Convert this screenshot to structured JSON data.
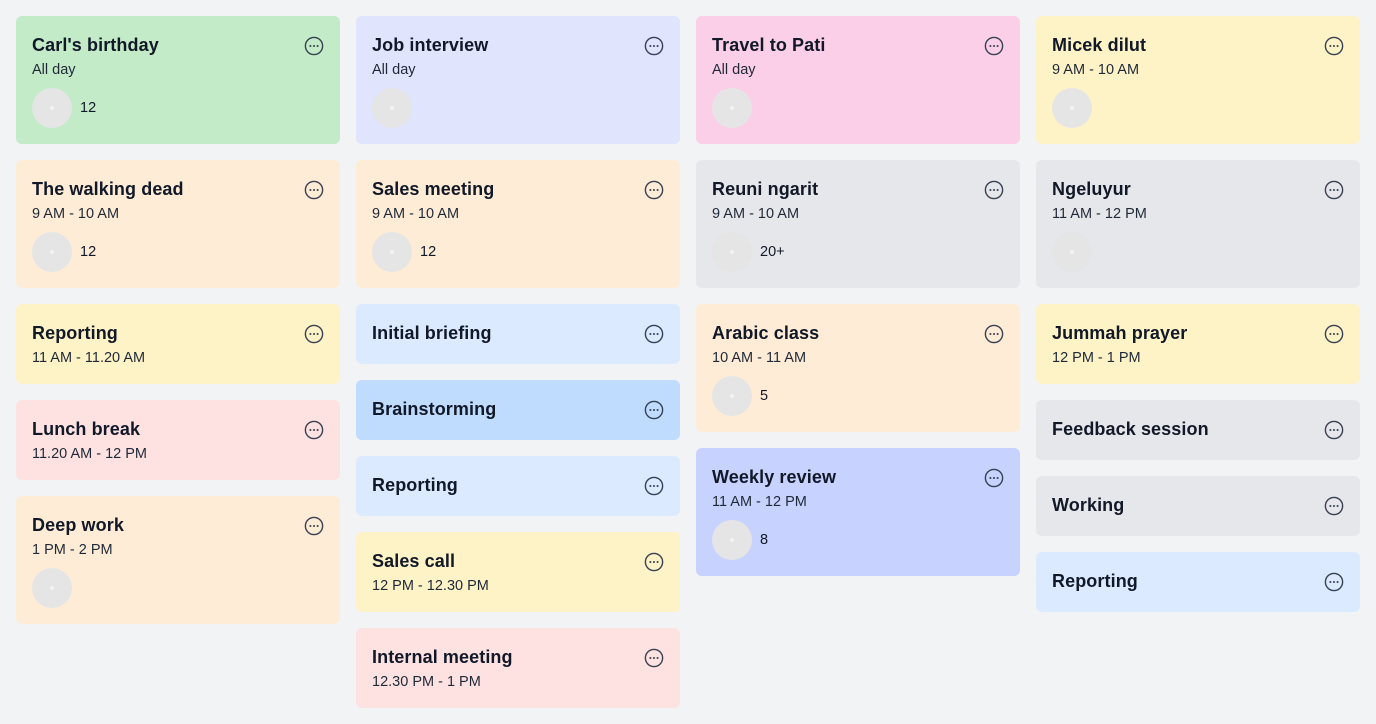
{
  "columns": [
    {
      "cards": [
        {
          "title": "Carl's birthday",
          "time": "All day",
          "count": "12",
          "color": "#c4ebc8"
        },
        {
          "title": "The walking dead",
          "time": "9 AM - 10 AM",
          "count": "12",
          "color": "#feecd6"
        },
        {
          "title": "Reporting",
          "time": "11 AM - 11.20 AM",
          "color": "#fef3c7"
        },
        {
          "title": "Lunch break",
          "time": "11.20 AM - 12 PM",
          "color": "#fee2e2"
        },
        {
          "title": "Deep work",
          "time": "1 PM - 2 PM",
          "count": "",
          "color": "#feecd6"
        }
      ]
    },
    {
      "cards": [
        {
          "title": "Job interview",
          "time": "All day",
          "count": "",
          "color": "#e0e4fc"
        },
        {
          "title": "Sales meeting",
          "time": "9 AM - 10 AM",
          "count": "12",
          "color": "#feecd6"
        },
        {
          "title": "Initial briefing",
          "color": "#dbeafe"
        },
        {
          "title": "Brainstorming",
          "color": "#bfdbfe"
        },
        {
          "title": "Reporting",
          "color": "#dbeafe"
        },
        {
          "title": "Sales call",
          "time": "12 PM - 12.30 PM",
          "color": "#fef3c7"
        },
        {
          "title": "Internal meeting",
          "time": "12.30 PM - 1 PM",
          "color": "#fee2e2"
        }
      ]
    },
    {
      "cards": [
        {
          "title": "Travel to Pati",
          "time": "All day",
          "count": "",
          "color": "#fbcfe8"
        },
        {
          "title": "Reuni ngarit",
          "time": "9 AM - 10 AM",
          "count": "20+",
          "color": "#e5e7eb"
        },
        {
          "title": "Arabic class",
          "time": "10 AM - 11 AM",
          "count": "5",
          "color": "#feecd6"
        },
        {
          "title": "Weekly review",
          "time": "11 AM - 12 PM",
          "count": "8",
          "color": "#c7d2fe"
        }
      ]
    },
    {
      "cards": [
        {
          "title": "Micek dilut",
          "time": "9 AM - 10 AM",
          "count": "",
          "color": "#fef3c7"
        },
        {
          "title": "Ngeluyur",
          "time": "11 AM - 12 PM",
          "count": "",
          "color": "#e5e7eb"
        },
        {
          "title": "Jummah prayer",
          "time": "12 PM - 1 PM",
          "color": "#fef3c7"
        },
        {
          "title": "Feedback session",
          "color": "#e5e7eb"
        },
        {
          "title": "Working",
          "color": "#e5e7eb"
        },
        {
          "title": "Reporting",
          "color": "#dbeafe"
        }
      ]
    }
  ],
  "icons": {
    "more": "more-options-icon",
    "avatar": "avatar"
  }
}
